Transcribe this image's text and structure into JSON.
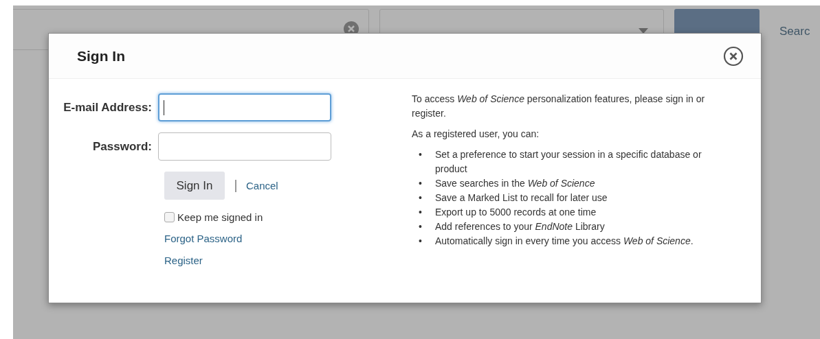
{
  "background": {
    "link": "Searc"
  },
  "dialog": {
    "title": "Sign In",
    "fields": [
      {
        "label": "E-mail Address:",
        "focused": true
      },
      {
        "label": "Password:",
        "focused": false
      }
    ],
    "sign_in_button": "Sign In",
    "cancel_link": "Cancel",
    "keep_signed_in": {
      "label": "Keep me signed in",
      "checked": false
    },
    "links": [
      "Forgot Password",
      "Register"
    ],
    "intro": "To access *Web of Science* personalization features, please sign in or register.",
    "list_heading": "As a registered user, you can:",
    "benefits": [
      {
        "marker": "•",
        "text": "Set a preference to start your session in a specific database or product"
      },
      {
        "marker": "•",
        "text": "Save searches in the *Web of Science*"
      },
      {
        "marker": "•",
        "text": "Save a Marked List to recall for later use"
      },
      {
        "marker": "•",
        "text": "Export up to 5000 records at one time"
      },
      {
        "marker": "•",
        "text": "Add references to your *EndNote* Library"
      },
      {
        "marker": "•",
        "text": "Automatically sign in every time you access *Web of Science*."
      }
    ]
  }
}
